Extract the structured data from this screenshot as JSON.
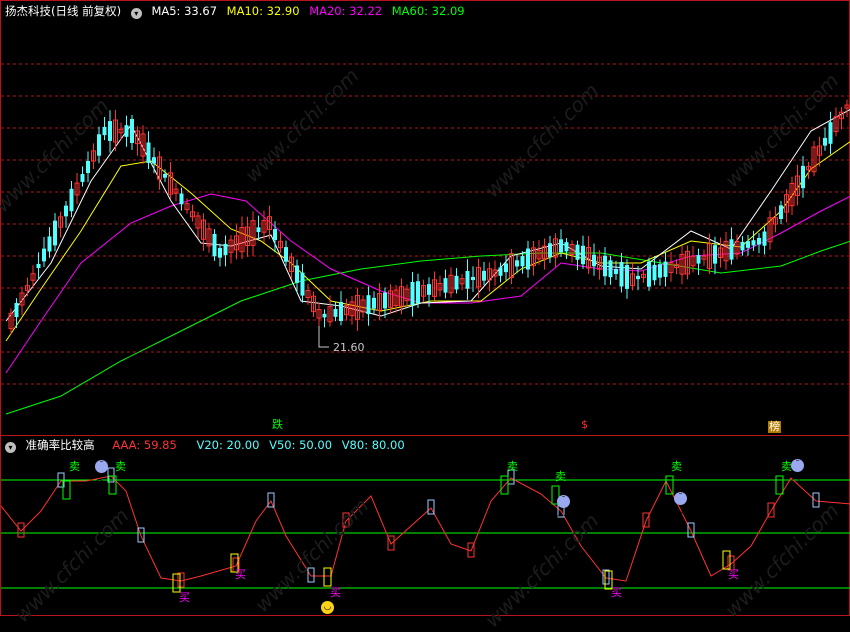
{
  "main_header": {
    "title": "扬杰科技(日线 前复权)",
    "ma5_label": "MA5: 33.67",
    "ma10_label": "MA10: 32.90",
    "ma20_label": "MA20: 32.22",
    "ma60_label": "MA60: 32.09",
    "colors": {
      "ma5": "#ffffff",
      "ma10": "#ffff00",
      "ma20": "#ff00ff",
      "ma60": "#00ff00"
    }
  },
  "low_marker": "21.60",
  "event_markers": [
    "跌",
    "$",
    "榜"
  ],
  "sub_header": {
    "title": "准确率比较高",
    "aaa_label": "AAA: 59.85",
    "v20_label": "V20: 20.00",
    "v50_label": "V50: 50.00",
    "v80_label": "V80: 80.00"
  },
  "signal_text": {
    "sell": "卖",
    "buy": "买"
  },
  "watermark": "www.cfchi.com",
  "colors": {
    "up": "#ff3232",
    "down": "#54ffff",
    "grid": "#b8131a",
    "level_line": "#00ff00",
    "buy": "#ff00ff",
    "sell": "#00ff00"
  }
}
